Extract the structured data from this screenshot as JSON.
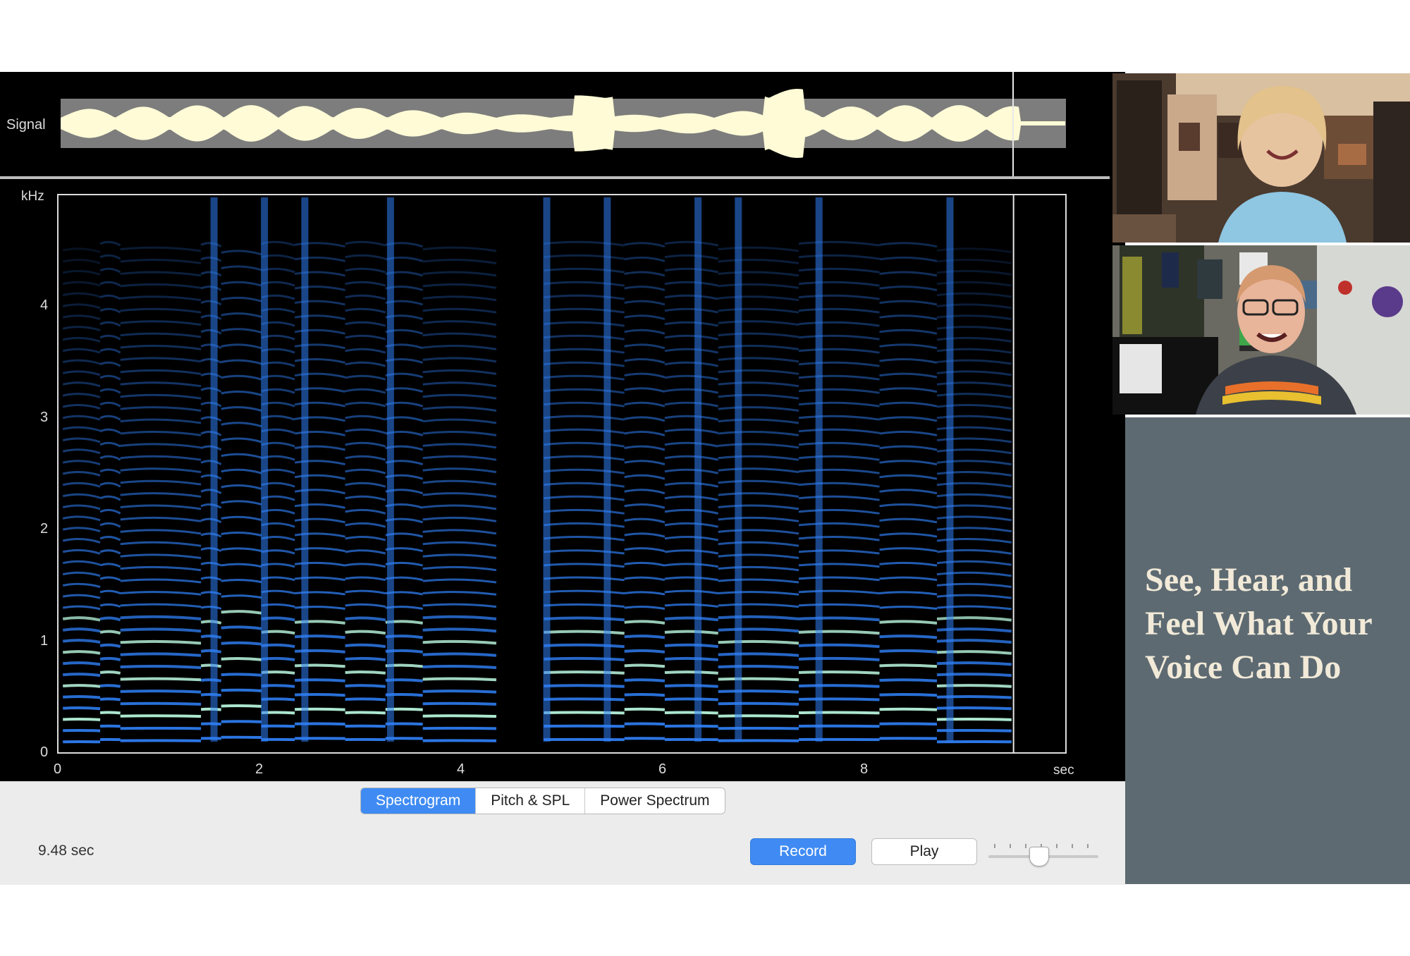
{
  "signal": {
    "label": "Signal"
  },
  "spectrogram": {
    "y_unit": "kHz",
    "x_unit": "sec",
    "y_ticks": [
      "0",
      "1",
      "2",
      "3",
      "4"
    ],
    "x_ticks": [
      "0",
      "2",
      "4",
      "6",
      "8"
    ],
    "time_range_sec": [
      0,
      10
    ],
    "freq_range_khz": [
      0,
      5
    ],
    "playhead_sec": 9.48,
    "colors": {
      "background": "#000000",
      "harmonics": "#2f7ff5",
      "bright": "#bfffe6",
      "waveform": "#fffbd6"
    }
  },
  "tabs": [
    {
      "label": "Spectrogram",
      "active": true
    },
    {
      "label": "Pitch & SPL",
      "active": false
    },
    {
      "label": "Power Spectrum",
      "active": false
    }
  ],
  "status": {
    "duration": "9.48 sec"
  },
  "buttons": {
    "record": "Record",
    "play": "Play"
  },
  "slider": {
    "value": 0.48
  },
  "sidebar": {
    "headline": "See, Hear, and Feel What Your Voice Can Do",
    "background": "#5d6a72"
  },
  "videos": [
    {
      "name": "participant-1"
    },
    {
      "name": "participant-2"
    }
  ]
}
